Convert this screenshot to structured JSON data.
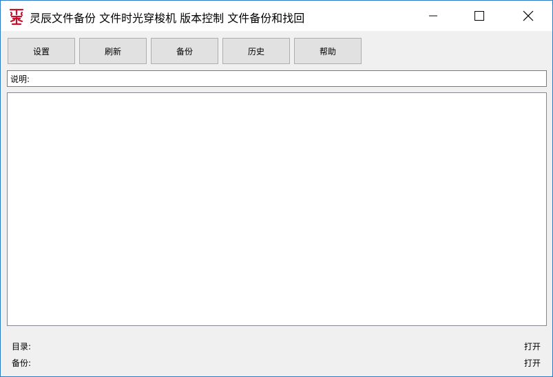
{
  "window": {
    "title": "灵辰文件备份    文件时光穿梭机 版本控制 文件备份和找回",
    "icons": {
      "app": "seal-logo-icon",
      "minimize": "minimize-icon",
      "maximize": "maximize-icon",
      "close": "close-icon"
    },
    "colors": {
      "border": "#2b79c2",
      "logo": "#c8102e"
    }
  },
  "toolbar": {
    "settings_label": "设置",
    "refresh_label": "刷新",
    "backup_label": "备份",
    "history_label": "历史",
    "help_label": "帮助"
  },
  "description": {
    "label": "说明:",
    "value": ""
  },
  "footer": {
    "directory_label": "目录:",
    "directory_open": "打开",
    "backup_label": "备份:",
    "backup_open": "打开"
  }
}
